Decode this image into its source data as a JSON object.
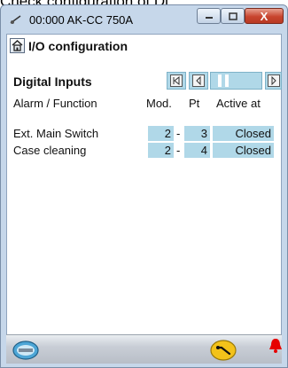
{
  "caption": {
    "text": "Check configuration of Di"
  },
  "window": {
    "title": "00:000 AK-CC 750A",
    "close_glyph": "X"
  },
  "page": {
    "title": "I/O configuration",
    "section": "Digital Inputs"
  },
  "columns": {
    "alarm": "Alarm / Function",
    "mod": "Mod.",
    "pt": "Pt",
    "active": "Active at"
  },
  "rows": [
    {
      "label": "Ext. Main Switch",
      "mod": "2",
      "sep": "-",
      "pt": "3",
      "active": "Closed"
    },
    {
      "label": "Case cleaning",
      "mod": "2",
      "sep": "-",
      "pt": "4",
      "active": "Closed"
    }
  ],
  "nav": {
    "first_icon": "first-page-icon",
    "prev_icon": "previous-icon",
    "next_icon": "next-icon"
  },
  "colors": {
    "cell_bg": "#b0d8e8",
    "titlebar": "#c6d7ea",
    "close": "#c8452e",
    "alarm": "#e60000"
  }
}
